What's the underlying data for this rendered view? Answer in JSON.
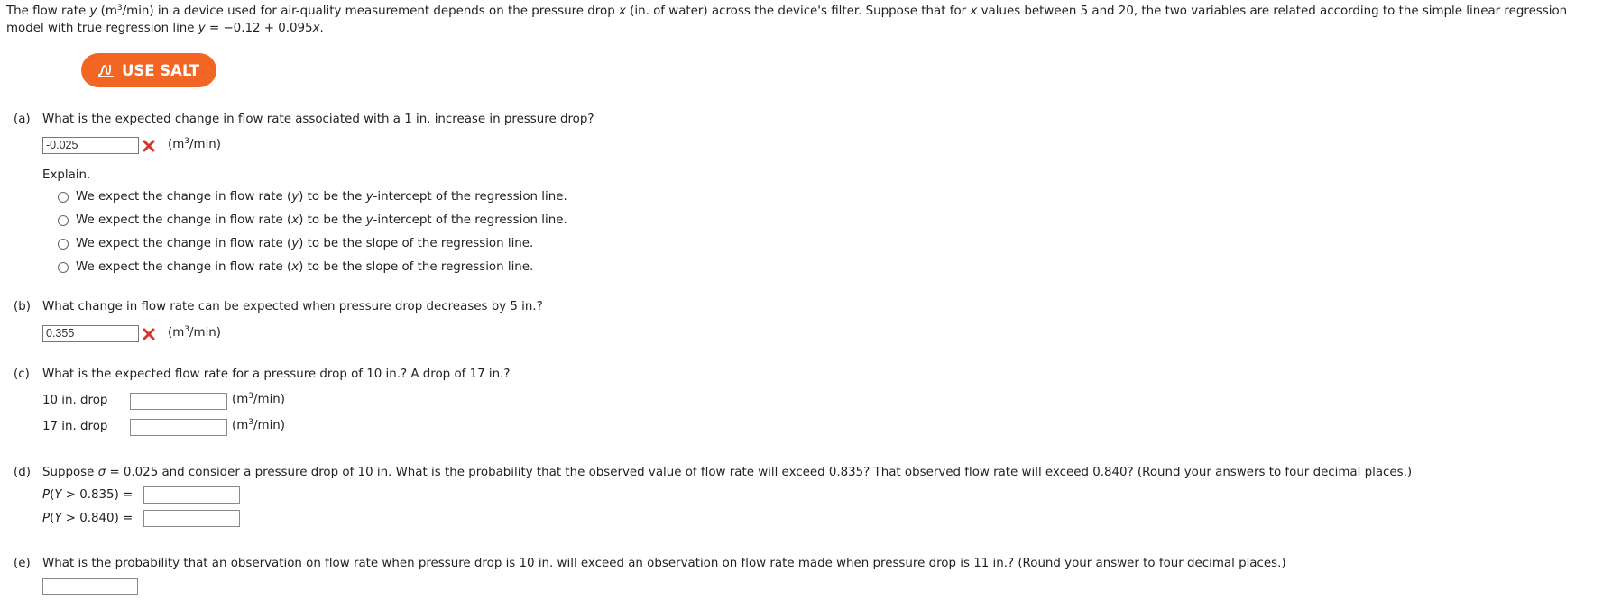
{
  "intro": {
    "part1": "The flow rate ",
    "var_y": "y",
    "part2": " (m",
    "sup3": "3",
    "part3": "/min) in a device used for air-quality measurement depends on the pressure drop ",
    "var_x": "x",
    "part4": " (in. of water) across the device's filter. Suppose that for ",
    "var_x2": "x",
    "part5": " values between 5 and 20, the two variables are related according to the simple linear regression model with true regression line ",
    "eq_y": "y",
    "eq_rest": " = −0.12 + 0.095",
    "eq_x": "x",
    "eq_end": "."
  },
  "salt_button": {
    "label": "USE SALT"
  },
  "units": {
    "m": "(m",
    "sup": "3",
    "rest": "/min)"
  },
  "part_a": {
    "label": "(a)",
    "question": "What is the expected change in flow rate associated with a 1 in. increase in pressure drop?",
    "answer": "-0.025",
    "explain_label": "Explain.",
    "options": [
      {
        "pre": "We expect the change in flow rate (",
        "var": "y",
        "post": ") to be the ",
        "var2": "y",
        "post2": "-intercept of the regression line."
      },
      {
        "pre": "We expect the change in flow rate (",
        "var": "x",
        "post": ") to be the ",
        "var2": "y",
        "post2": "-intercept of the regression line."
      },
      {
        "pre": "We expect the change in flow rate (",
        "var": "y",
        "post": ") to be the slope of the regression line.",
        "var2": "",
        "post2": ""
      },
      {
        "pre": "We expect the change in flow rate (",
        "var": "x",
        "post": ") to be the slope of the regression line.",
        "var2": "",
        "post2": ""
      }
    ]
  },
  "part_b": {
    "label": "(b)",
    "question": "What change in flow rate can be expected when pressure drop decreases by 5 in.?",
    "answer": "0.355"
  },
  "part_c": {
    "label": "(c)",
    "question": "What is the expected flow rate for a pressure drop of 10 in.? A drop of 17 in.?",
    "row1_label": "10 in. drop",
    "row2_label": "17 in. drop",
    "row1_value": "",
    "row2_value": ""
  },
  "part_d": {
    "label": "(d)",
    "q_pre": "Suppose ",
    "sigma": "σ",
    "q_post": " = 0.025 and consider a pressure drop of 10 in. What is the probability that the observed value of flow rate will exceed 0.835? That observed flow rate will exceed 0.840? (Round your answers to four decimal places.)",
    "p1_P": "P",
    "p1_Y": "Y",
    "p1_rest": " > 0.835)  =",
    "p2_P": "P",
    "p2_Y": "Y",
    "p2_rest": " > 0.840)  =",
    "p1_value": "",
    "p2_value": ""
  },
  "part_e": {
    "label": "(e)",
    "question": "What is the probability that an observation on flow rate when pressure drop is 10 in. will exceed an observation on flow rate made when pressure drop is 11 in.? (Round your answer to four decimal places.)",
    "value": ""
  },
  "colors": {
    "salt_orange": "#f26522",
    "error_red": "#d9342b"
  }
}
